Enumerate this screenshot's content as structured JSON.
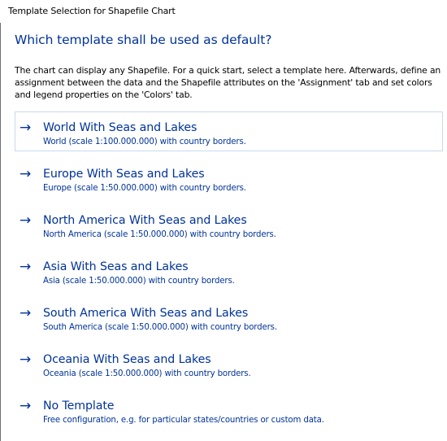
{
  "window": {
    "title": "Template Selection for Shapefile Chart"
  },
  "heading": "Which template shall be used as default?",
  "description": "The chart can display any Shapefile. For a quick start, select a template here. Afterwards, define an assignment between the data and the Shapefile attributes on the 'Assignment' tab and set colors and legend properties on the 'Colors' tab.",
  "options": [
    {
      "title": "World With Seas and Lakes",
      "subtitle": "World (scale 1:100.000.000) with country borders.",
      "selected": true
    },
    {
      "title": "Europe With Seas and Lakes",
      "subtitle": "Europe (scale 1:50.000.000) with country borders.",
      "selected": false
    },
    {
      "title": "North America With Seas and Lakes",
      "subtitle": "North America (scale 1:50.000.000) with country borders.",
      "selected": false
    },
    {
      "title": "Asia With Seas and Lakes",
      "subtitle": "Asia (scale 1:50.000.000) with country borders.",
      "selected": false
    },
    {
      "title": "South America With Seas and Lakes",
      "subtitle": "South America (scale 1:50.000.000) with country borders.",
      "selected": false
    },
    {
      "title": "Oceania With Seas and Lakes",
      "subtitle": "Oceania (scale 1:50.000.000) with country borders.",
      "selected": false
    },
    {
      "title": "No Template",
      "subtitle": "Free configuration, e.g. for particular states/countries or custom data.",
      "selected": false
    }
  ],
  "arrow_glyph": "→",
  "colors": {
    "link_blue": "#003399",
    "selected_border": "#c9d9ea",
    "background": "#ffffff"
  },
  "icons": {
    "option_arrow": "right-arrow-icon"
  }
}
